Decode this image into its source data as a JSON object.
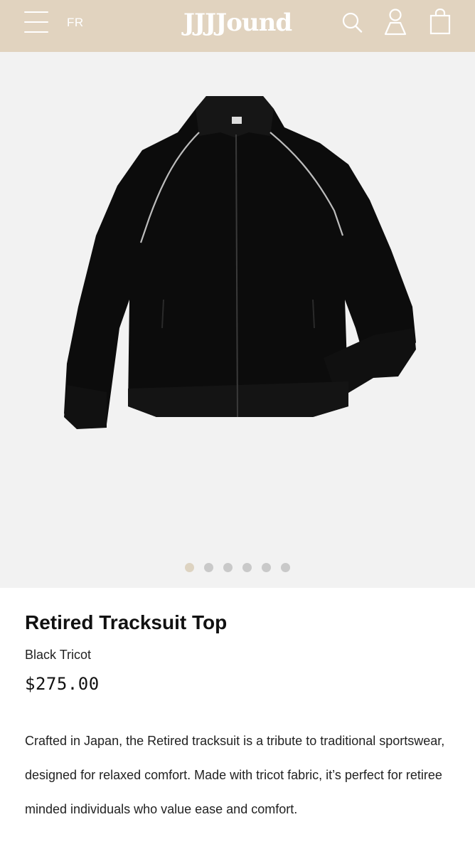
{
  "header": {
    "language": "FR",
    "logo": "JJJJound",
    "icons": [
      "menu-icon",
      "search-icon",
      "account-icon",
      "cart-icon"
    ],
    "background_color": "#e1d3bf"
  },
  "gallery": {
    "image_count": 6,
    "active_index": 0,
    "image_alt": "Black tracksuit jacket with white piping"
  },
  "product": {
    "title": "Retired Tracksuit Top",
    "variant": "Black Tricot",
    "price": "$275.00",
    "description": "Crafted in Japan, the Retired tracksuit is a tribute to traditional sportswear, designed for relaxed comfort. Made with tricot fabric, it’s perfect for retiree minded individuals who value ease and comfort."
  }
}
